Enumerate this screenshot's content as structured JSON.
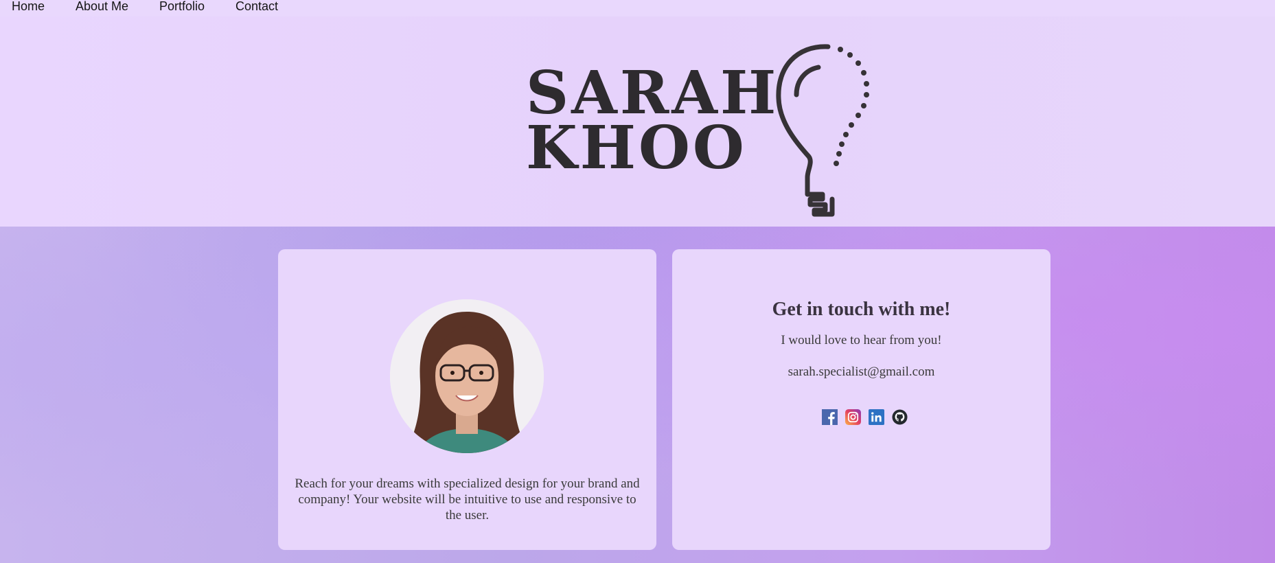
{
  "nav": {
    "items": [
      {
        "label": "Home"
      },
      {
        "label": "About Me"
      },
      {
        "label": "Portfolio"
      },
      {
        "label": "Contact"
      }
    ]
  },
  "logo": {
    "line1": "SARAH",
    "line2": "KHOO",
    "icon": "lightbulb-head-icon"
  },
  "about": {
    "photo": "profile-photo",
    "bio": "Reach for your dreams with specialized design for your brand and company! Your website will be intuitive to use and responsive to the user."
  },
  "contact": {
    "title": "Get in touch with me!",
    "subtitle": "I would love to hear from you!",
    "email": "sarah.specialist@gmail.com",
    "socials": [
      {
        "icon": "facebook-icon",
        "color": "#3b5998"
      },
      {
        "icon": "instagram-icon",
        "color": "#c13584"
      },
      {
        "icon": "linkedin-icon",
        "color": "#2d72c4"
      },
      {
        "icon": "github-icon",
        "color": "#24292e"
      }
    ]
  }
}
